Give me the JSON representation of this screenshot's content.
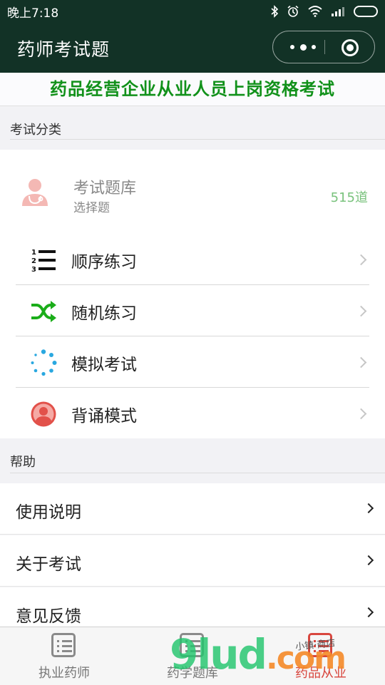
{
  "status_bar": {
    "time": "晚上7:18"
  },
  "header": {
    "title": "药师考试题"
  },
  "banner": {
    "text": "药品经营企业从业人员上岗资格考试"
  },
  "sections": {
    "exam_category": "考试分类",
    "help": "帮助"
  },
  "question_bank": {
    "title": "考试题库",
    "subtitle": "选择题",
    "count": "515道"
  },
  "menu": [
    {
      "label": "顺序练习",
      "icon": "ordered-list-icon"
    },
    {
      "label": "随机练习",
      "icon": "shuffle-icon"
    },
    {
      "label": "模拟考试",
      "icon": "loading-dots-icon"
    },
    {
      "label": "背诵模式",
      "icon": "user-avatar-icon"
    }
  ],
  "help_items": [
    {
      "label": "使用说明"
    },
    {
      "label": "关于考试"
    },
    {
      "label": "意见反馈"
    }
  ],
  "tabs": [
    {
      "label": "执业药师",
      "active": false
    },
    {
      "label": "药学题库",
      "active": false
    },
    {
      "label": "药品从业",
      "active": true
    }
  ],
  "watermark": {
    "text_main": "9lud",
    "text_dot": ".com",
    "text_small": "小镇·商店"
  },
  "colors": {
    "header_bg": "#123226",
    "banner_text": "#11911a",
    "accent_red": "#d8463e",
    "count_green": "#79c27c",
    "shuffle_green": "#1aad19",
    "loading_blue": "#2aa8e0"
  }
}
